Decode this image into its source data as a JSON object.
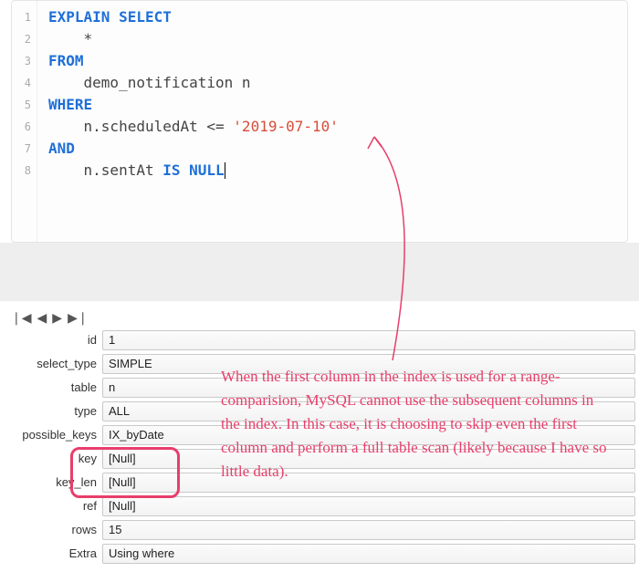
{
  "code": {
    "gutter": [
      "1",
      "2",
      "3",
      "4",
      "5",
      "6",
      "7",
      "8"
    ],
    "l1a": "EXPLAIN",
    "l1b": "SELECT",
    "l2": "    *",
    "l3a": "FROM",
    "l4": "    demo_notification n",
    "l5a": "WHERE",
    "l6a": "    n.scheduledAt <= ",
    "l6b": "'2019-07-10'",
    "l7a": "AND",
    "l8a": "    n.sentAt ",
    "l8b": "IS NULL"
  },
  "nav": {
    "first": "❘◀",
    "prev": "◀",
    "next": "▶",
    "last": "▶❘"
  },
  "rows": [
    {
      "label": "id",
      "value": "1"
    },
    {
      "label": "select_type",
      "value": "SIMPLE"
    },
    {
      "label": "table",
      "value": "n"
    },
    {
      "label": "type",
      "value": "ALL"
    },
    {
      "label": "possible_keys",
      "value": "IX_byDate"
    },
    {
      "label": "key",
      "value": "[Null]"
    },
    {
      "label": "key_len",
      "value": "[Null]"
    },
    {
      "label": "ref",
      "value": "[Null]"
    },
    {
      "label": "rows",
      "value": "15"
    },
    {
      "label": "Extra",
      "value": "Using where"
    }
  ],
  "annotation": "When the first column in the index is used for a range-comparision, MySQL cannot use the subsequent columns in the index. In this case, it is choosing to skip even the first column and perform a full table scan (likely because I have so little data)."
}
